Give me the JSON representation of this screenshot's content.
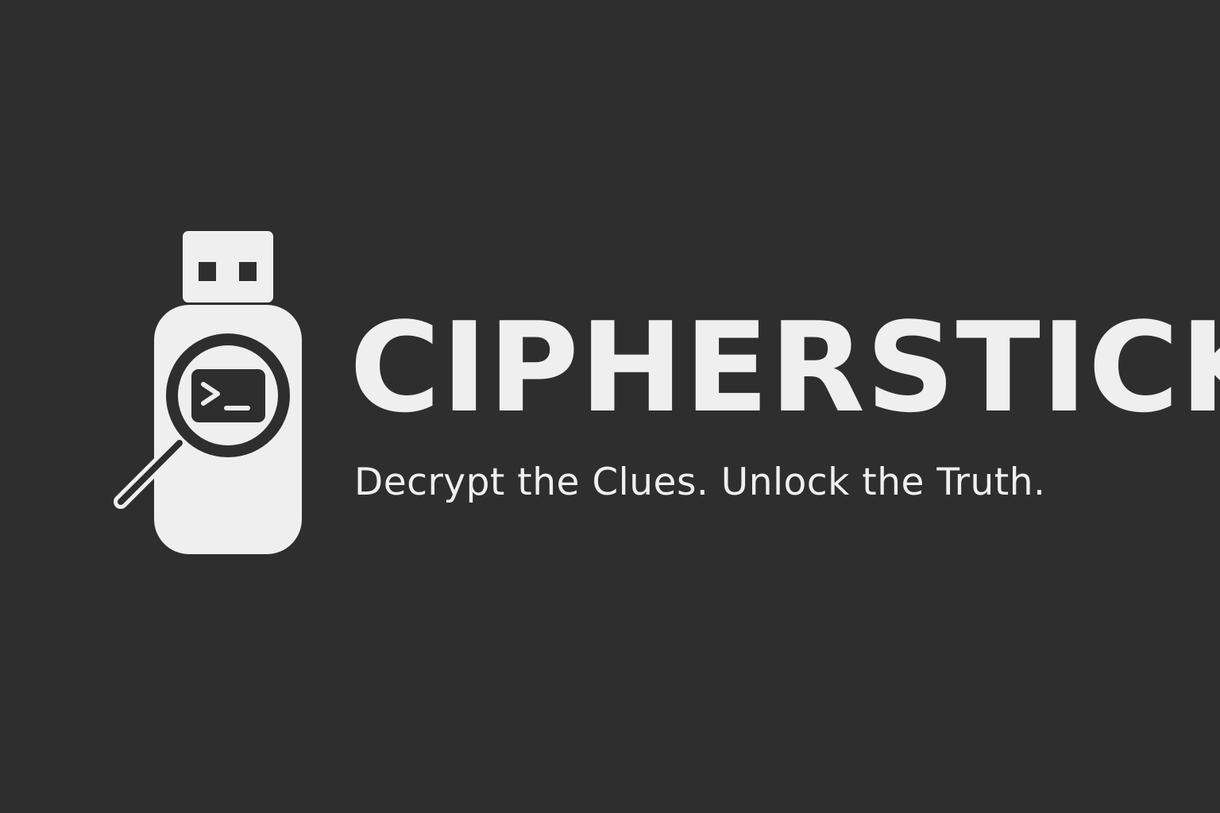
{
  "brand": {
    "name": "CIPHERSTICK",
    "tagline": "Decrypt the Clues. Unlock the Truth.",
    "icon": "usb-drive-magnifier-terminal-icon"
  },
  "colors": {
    "background": "#2e2e2e",
    "foreground": "#efefef"
  }
}
